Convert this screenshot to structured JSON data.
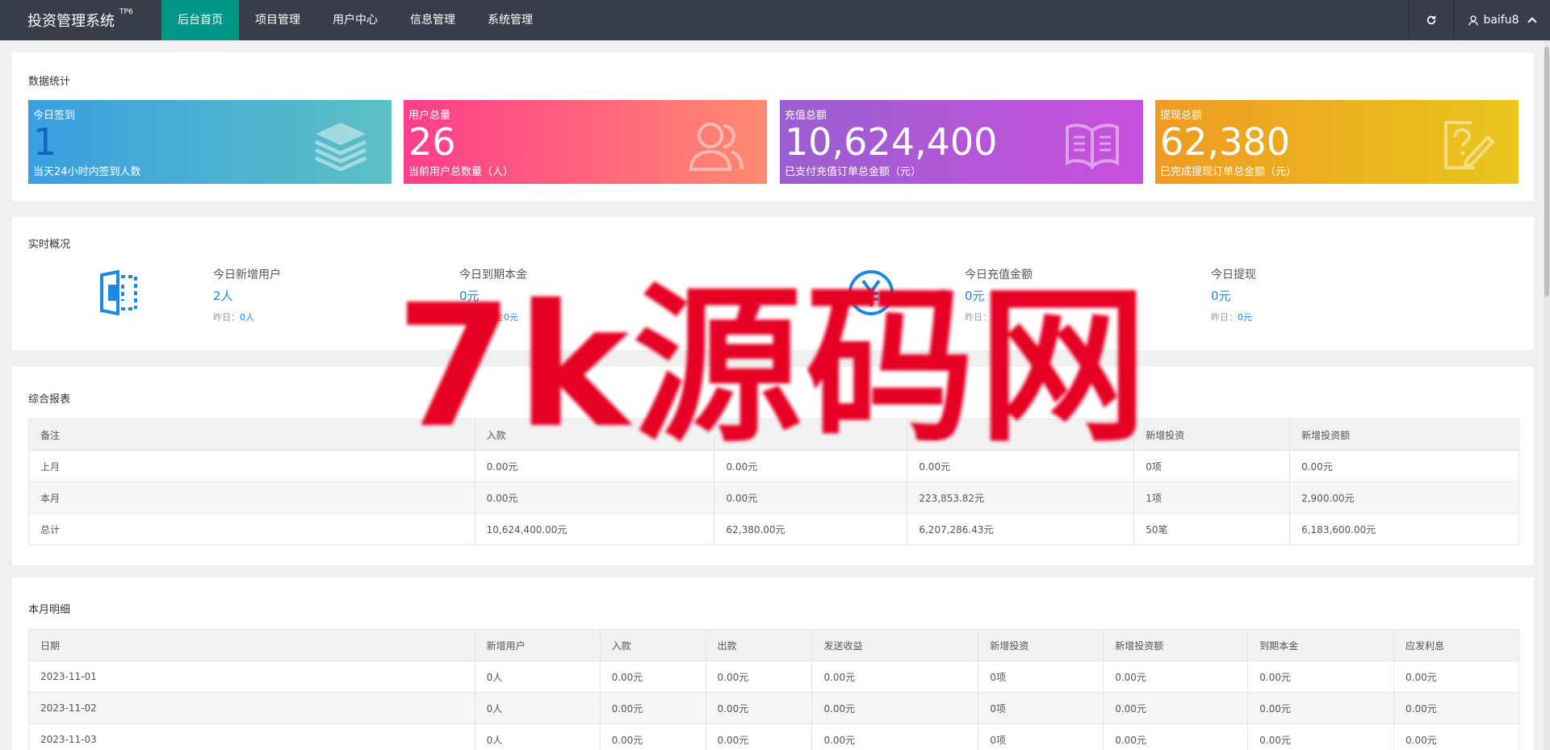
{
  "app": {
    "title": "投资管理系统",
    "version_badge": "TP6"
  },
  "nav": [
    {
      "label": "后台首页",
      "active": true
    },
    {
      "label": "项目管理",
      "active": false
    },
    {
      "label": "用户中心",
      "active": false
    },
    {
      "label": "信息管理",
      "active": false
    },
    {
      "label": "系统管理",
      "active": false
    }
  ],
  "user": {
    "name": "baifu8"
  },
  "stats": {
    "title": "数据统计",
    "cards": [
      {
        "label": "今日签到",
        "value": "1",
        "sub": "当天24小时内签到人数",
        "icon": "layers-icon"
      },
      {
        "label": "用户总量",
        "value": "26",
        "sub": "当前用户总数量（人）",
        "icon": "users-icon"
      },
      {
        "label": "充值总额",
        "value": "10,624,400",
        "sub": "已支付充值订单总金额（元）",
        "icon": "book-icon"
      },
      {
        "label": "提现总额",
        "value": "62,380",
        "sub": "已完成提现订单总金额（元）",
        "icon": "question-edit-icon"
      }
    ]
  },
  "realtime": {
    "title": "实时概况",
    "items": [
      {
        "label": "今日新增用户",
        "value": "2人",
        "yesterday_label": "昨日：",
        "yesterday_value": "0人"
      },
      {
        "label": "今日到期本金",
        "value": "0元",
        "yesterday_label": "今日到期金",
        "yesterday_value": "0元"
      },
      {
        "label": "今日充值金额",
        "value": "0元",
        "yesterday_label": "昨日：",
        "yesterday_value": ""
      },
      {
        "label": "今日提现",
        "value": "0元",
        "yesterday_label": "昨日：",
        "yesterday_value": "0元"
      }
    ]
  },
  "report": {
    "title": "综合报表",
    "headers": [
      "备注",
      "入款",
      "",
      "发送",
      "新增投资",
      "新增投资额"
    ],
    "rows": [
      [
        "上月",
        "0.00元",
        "0.00元",
        "0.00元",
        "0项",
        "0.00元"
      ],
      [
        "本月",
        "0.00元",
        "0.00元",
        "223,853.82元",
        "1项",
        "2,900.00元"
      ],
      [
        "总计",
        "10,624,400.00元",
        "62,380.00元",
        "6,207,286.43元",
        "50笔",
        "6,183,600.00元"
      ]
    ]
  },
  "monthly": {
    "title": "本月明细",
    "headers": [
      "日期",
      "新增用户",
      "入款",
      "出款",
      "发送收益",
      "新增投资",
      "新增投资额",
      "到期本金",
      "应发利息"
    ],
    "rows": [
      [
        "2023-11-01",
        "0人",
        "0.00元",
        "0.00元",
        "0.00元",
        "0项",
        "0.00元",
        "0.00元",
        "0.00元"
      ],
      [
        "2023-11-02",
        "0人",
        "0.00元",
        "0.00元",
        "0.00元",
        "0项",
        "0.00元",
        "0.00元",
        "0.00元"
      ],
      [
        "2023-11-03",
        "0人",
        "0.00元",
        "0.00元",
        "0.00元",
        "0项",
        "0.00元",
        "0.00元",
        "0.00元"
      ]
    ]
  },
  "watermark": "7k源码网",
  "colors": {
    "nav_bg": "#393d49",
    "nav_active": "#009688",
    "card1": [
      "#3a9fe0",
      "#5cc0c4"
    ],
    "card2": [
      "#ff3d8b",
      "#ff8a70"
    ],
    "card3": [
      "#9a5fd1",
      "#c94fdd"
    ],
    "card4": [
      "#ef9b23",
      "#e9c61d"
    ],
    "link_blue": "#1e88e5",
    "watermark_red": "#e60023"
  }
}
